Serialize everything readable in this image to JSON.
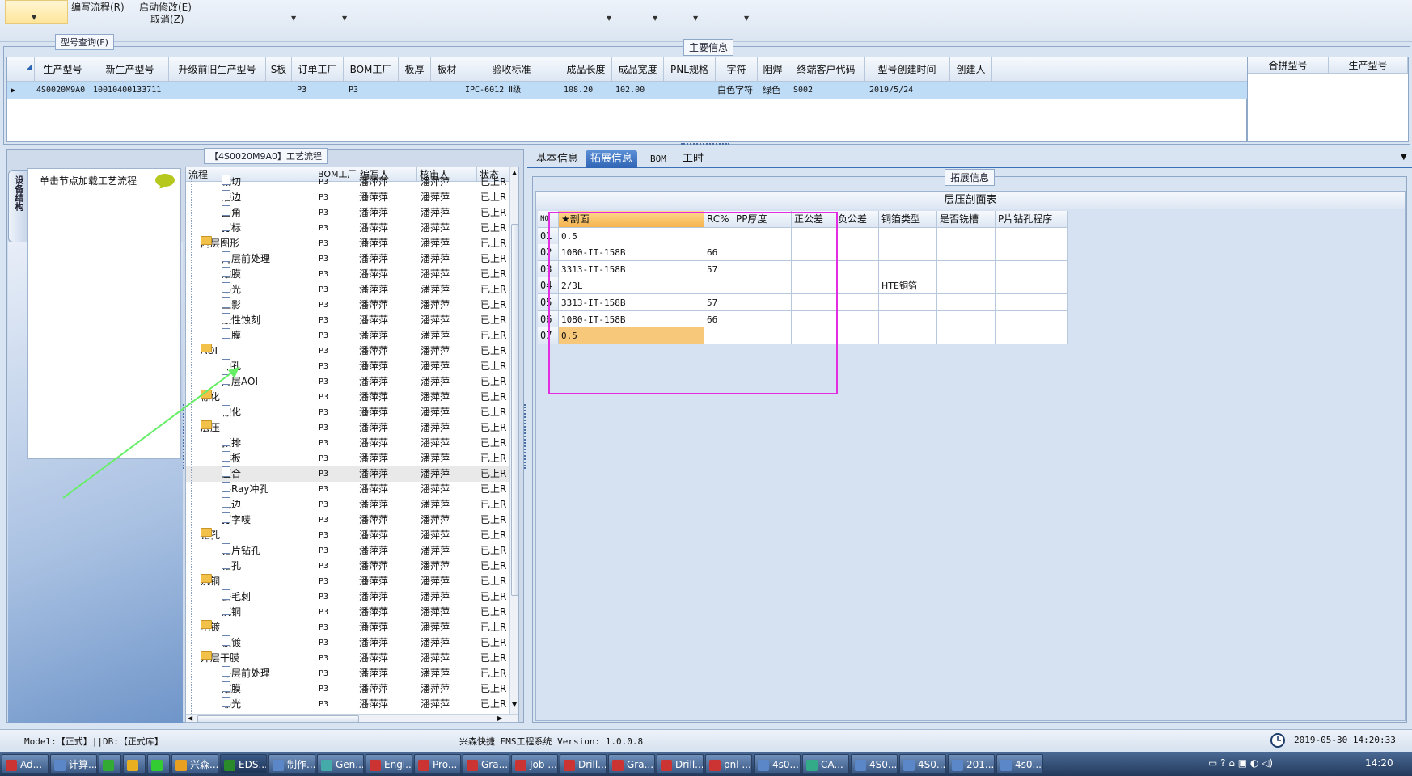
{
  "toolbar": {
    "menu1": "编写流程(R)",
    "menu2": "启动修改(E)",
    "menu3": "取消(Z)",
    "query_button": "型号查询(F)"
  },
  "main_info": {
    "legend": "主要信息",
    "columns": [
      "生产型号",
      "新生产型号",
      "升级前旧生产型号",
      "S板",
      "订单工厂",
      "BOM工厂",
      "板厚",
      "板材",
      "验收标准",
      "成品长度",
      "成品宽度",
      "PNL规格",
      "字符",
      "阻焊",
      "终端客户代码",
      "型号创建时间",
      "创建人"
    ],
    "row": [
      "4S0020M9A0",
      "10010400133711",
      "",
      "",
      "P3",
      "P3",
      "",
      "",
      "IPC-6012 Ⅱ级",
      "108.20",
      "102.00",
      "",
      "白色字符",
      "绿色",
      "S002",
      "2019/5/24",
      ""
    ],
    "side_columns": [
      "合拼型号",
      "生产型号"
    ]
  },
  "process": {
    "title": "【4S0020M9A0】工艺流程",
    "vertical_tab": "设备结构",
    "load_hint": "单击节点加载工艺流程",
    "columns": [
      "流程",
      "BOM工厂",
      "编写人",
      "核审人",
      "状态"
    ],
    "rows": [
      {
        "name": "裁切",
        "type": "doc",
        "level": 2,
        "bom": "P3",
        "writer": "潘萍萍",
        "reviewer": "潘萍萍",
        "status": "已上R"
      },
      {
        "name": "磨边",
        "type": "doc",
        "level": 2,
        "bom": "P3",
        "writer": "潘萍萍",
        "reviewer": "潘萍萍",
        "status": "已上R"
      },
      {
        "name": "圆角",
        "type": "doc",
        "level": 2,
        "bom": "P3",
        "writer": "潘萍萍",
        "reviewer": "潘萍萍",
        "status": "已上R"
      },
      {
        "name": "打标",
        "type": "doc",
        "level": 2,
        "bom": "P3",
        "writer": "潘萍萍",
        "reviewer": "潘萍萍",
        "status": "已上R"
      },
      {
        "name": "内层图形",
        "type": "folder",
        "level": 1,
        "bom": "P3",
        "writer": "潘萍萍",
        "reviewer": "潘萍萍",
        "status": "已上R"
      },
      {
        "name": "内层前处理",
        "type": "doc",
        "level": 2,
        "bom": "P3",
        "writer": "潘萍萍",
        "reviewer": "潘萍萍",
        "status": "已上R"
      },
      {
        "name": "贴膜",
        "type": "doc",
        "level": 2,
        "bom": "P3",
        "writer": "潘萍萍",
        "reviewer": "潘萍萍",
        "status": "已上R"
      },
      {
        "name": "曝光",
        "type": "doc",
        "level": 2,
        "bom": "P3",
        "writer": "潘萍萍",
        "reviewer": "潘萍萍",
        "status": "已上R"
      },
      {
        "name": "显影",
        "type": "doc",
        "level": 2,
        "bom": "P3",
        "writer": "潘萍萍",
        "reviewer": "潘萍萍",
        "status": "已上R"
      },
      {
        "name": "酸性蚀刻",
        "type": "doc",
        "level": 2,
        "bom": "P3",
        "writer": "潘萍萍",
        "reviewer": "潘萍萍",
        "status": "已上R"
      },
      {
        "name": "退膜",
        "type": "doc",
        "level": 2,
        "bom": "P3",
        "writer": "潘萍萍",
        "reviewer": "潘萍萍",
        "status": "已上R"
      },
      {
        "name": "AOI",
        "type": "folder",
        "level": 1,
        "bom": "P3",
        "writer": "潘萍萍",
        "reviewer": "潘萍萍",
        "status": "已上R"
      },
      {
        "name": "冲孔",
        "type": "doc",
        "level": 2,
        "bom": "P3",
        "writer": "潘萍萍",
        "reviewer": "潘萍萍",
        "status": "已上R"
      },
      {
        "name": "内层AOI",
        "type": "doc",
        "level": 2,
        "bom": "P3",
        "writer": "潘萍萍",
        "reviewer": "潘萍萍",
        "status": "已上R"
      },
      {
        "name": "棕化",
        "type": "folder",
        "level": 1,
        "bom": "P3",
        "writer": "潘萍萍",
        "reviewer": "潘萍萍",
        "status": "已上R"
      },
      {
        "name": "棕化",
        "type": "doc",
        "level": 2,
        "bom": "P3",
        "writer": "潘萍萍",
        "reviewer": "潘萍萍",
        "status": "已上R"
      },
      {
        "name": "层压",
        "type": "folder",
        "level": 1,
        "bom": "P3",
        "writer": "潘萍萍",
        "reviewer": "潘萍萍",
        "status": "已上R"
      },
      {
        "name": "预排",
        "type": "doc",
        "level": 2,
        "bom": "P3",
        "writer": "潘萍萍",
        "reviewer": "潘萍萍",
        "status": "已上R"
      },
      {
        "name": "排板",
        "type": "doc",
        "level": 2,
        "bom": "P3",
        "writer": "潘萍萍",
        "reviewer": "潘萍萍",
        "status": "已上R"
      },
      {
        "name": "压合",
        "type": "doc",
        "level": 2,
        "bom": "P3",
        "writer": "潘萍萍",
        "reviewer": "潘萍萍",
        "status": "已上R",
        "selected": true
      },
      {
        "name": "X-Ray冲孔",
        "type": "doc",
        "level": 2,
        "bom": "P3",
        "writer": "潘萍萍",
        "reviewer": "潘萍萍",
        "status": "已上R"
      },
      {
        "name": "铣边",
        "type": "doc",
        "level": 2,
        "bom": "P3",
        "writer": "潘萍萍",
        "reviewer": "潘萍萍",
        "status": "已上R"
      },
      {
        "name": "打字唛",
        "type": "doc",
        "level": 2,
        "bom": "P3",
        "writer": "潘萍萍",
        "reviewer": "潘萍萍",
        "status": "已上R"
      },
      {
        "name": "钻孔",
        "type": "folder",
        "level": 1,
        "bom": "P3",
        "writer": "潘萍萍",
        "reviewer": "潘萍萍",
        "status": "已上R"
      },
      {
        "name": "铝片钻孔",
        "type": "doc",
        "level": 2,
        "bom": "P3",
        "writer": "潘萍萍",
        "reviewer": "潘萍萍",
        "status": "已上R"
      },
      {
        "name": "钻孔",
        "type": "doc",
        "level": 2,
        "bom": "P3",
        "writer": "潘萍萍",
        "reviewer": "潘萍萍",
        "status": "已上R"
      },
      {
        "name": "沉铜",
        "type": "folder",
        "level": 1,
        "bom": "P3",
        "writer": "潘萍萍",
        "reviewer": "潘萍萍",
        "status": "已上R"
      },
      {
        "name": "去毛刺",
        "type": "doc",
        "level": 2,
        "bom": "P3",
        "writer": "潘萍萍",
        "reviewer": "潘萍萍",
        "status": "已上R"
      },
      {
        "name": "沉铜",
        "type": "doc",
        "level": 2,
        "bom": "P3",
        "writer": "潘萍萍",
        "reviewer": "潘萍萍",
        "status": "已上R"
      },
      {
        "name": "电镀",
        "type": "folder",
        "level": 1,
        "bom": "P3",
        "writer": "潘萍萍",
        "reviewer": "潘萍萍",
        "status": "已上R"
      },
      {
        "name": "板镀",
        "type": "doc",
        "level": 2,
        "bom": "P3",
        "writer": "潘萍萍",
        "reviewer": "潘萍萍",
        "status": "已上R"
      },
      {
        "name": "外层干膜",
        "type": "folder",
        "level": 1,
        "bom": "P3",
        "writer": "潘萍萍",
        "reviewer": "潘萍萍",
        "status": "已上R"
      },
      {
        "name": "外层前处理",
        "type": "doc",
        "level": 2,
        "bom": "P3",
        "writer": "潘萍萍",
        "reviewer": "潘萍萍",
        "status": "已上R"
      },
      {
        "name": "贴膜",
        "type": "doc",
        "level": 2,
        "bom": "P3",
        "writer": "潘萍萍",
        "reviewer": "潘萍萍",
        "status": "已上R"
      },
      {
        "name": "曝光",
        "type": "doc",
        "level": 2,
        "bom": "P3",
        "writer": "潘萍萍",
        "reviewer": "潘萍萍",
        "status": "已上R"
      }
    ]
  },
  "tabs": [
    "基本信息",
    "拓展信息",
    "BOM",
    "工时"
  ],
  "extended": {
    "legend": "拓展信息",
    "table_title": "层压剖面表",
    "columns": [
      "NO",
      "★剖面",
      "RC%",
      "PP厚度",
      "正公差",
      "负公差",
      "铜箔类型",
      "是否铣槽",
      "P片钻孔程序"
    ],
    "rows": [
      [
        "01",
        "0.5",
        "",
        "",
        "",
        "",
        "",
        "",
        ""
      ],
      [
        "02",
        "1080-IT-158B",
        "66",
        "",
        "",
        "",
        "",
        "",
        ""
      ],
      [
        "03",
        "3313-IT-158B",
        "57",
        "",
        "",
        "",
        "",
        "",
        ""
      ],
      [
        "04",
        "2/3L",
        "",
        "",
        "",
        "",
        "HTE铜箔",
        "",
        ""
      ],
      [
        "05",
        "3313-IT-158B",
        "57",
        "",
        "",
        "",
        "",
        "",
        ""
      ],
      [
        "06",
        "1080-IT-158B",
        "66",
        "",
        "",
        "",
        "",
        "",
        ""
      ],
      [
        "07",
        "0.5",
        "",
        "",
        "",
        "",
        "",
        "",
        ""
      ]
    ]
  },
  "status_bar": {
    "model": "Model:【正式】||DB:【正式库】",
    "system": "兴森快捷 EMS工程系统 Version: 1.0.0.8",
    "datetime": "2019-05-30 14:20:33"
  },
  "taskbar": {
    "items": [
      "Ad...",
      "计算...",
      "",
      "",
      "",
      "兴森...",
      "EDS...",
      "制作...",
      "Gen...",
      "Engi...",
      "Pro...",
      "Gra...",
      "Job ...",
      "Drill...",
      "Gra...",
      "Drill...",
      "pnl ...",
      "4s0...",
      "CA...",
      "4S0...",
      "4S0...",
      "201...",
      "4s0..."
    ],
    "clock": "14:20"
  },
  "colors": {
    "accent": "#2e64b4",
    "highlight": "#e22ee0",
    "selection_orange": "#f7c77a",
    "arrow": "#66ee66"
  }
}
